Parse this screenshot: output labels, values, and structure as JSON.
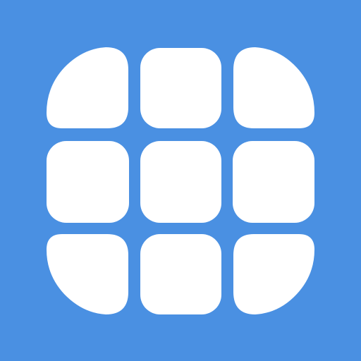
{
  "app_icon": {
    "icon_name": "grid-3x3-icon",
    "colors": {
      "background": "#4A90E2",
      "tile": "#FFFFFF"
    },
    "grid": {
      "rows": 3,
      "columns": 3
    },
    "tiles": [
      {
        "name": "tile-top-left"
      },
      {
        "name": "tile-top-center"
      },
      {
        "name": "tile-top-right"
      },
      {
        "name": "tile-middle-left"
      },
      {
        "name": "tile-center"
      },
      {
        "name": "tile-middle-right"
      },
      {
        "name": "tile-bottom-left"
      },
      {
        "name": "tile-bottom-center"
      },
      {
        "name": "tile-bottom-right"
      }
    ]
  }
}
